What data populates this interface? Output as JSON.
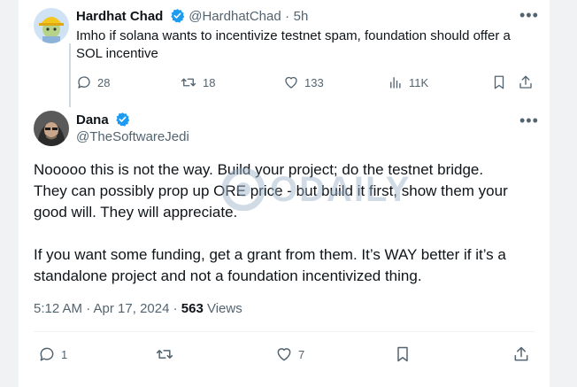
{
  "parent_tweet": {
    "author_name": "Hardhat Chad",
    "handle": "@HardhatChad",
    "separator": "·",
    "time": "5h",
    "text_line1": "Imho if solana wants to incentivize testnet spam, foundation should offer a",
    "text_line2": "SOL incentive",
    "replies": "28",
    "retweets": "18",
    "likes": "133",
    "views": "11K"
  },
  "main_tweet": {
    "author_name": "Dana",
    "handle": "@TheSoftwareJedi",
    "text_line1": "Nooooo this is not the way. Build your project; do the testnet bridge.",
    "text_line2": "They can possibly prop up ORE price - but build it first, show them your",
    "text_line3": "good will. They will appreciate.",
    "text_line4": "If you want some funding, get a grant from them. It’s WAY better if it’s a",
    "text_line5": "standalone project and not a foundation incentivized thing.",
    "timestamp": "5:12 AM · Apr 17, 2024 ·",
    "views_count": "563",
    "views_label": "Views",
    "replies": "1",
    "likes": "7"
  },
  "watermark": {
    "text": "ODAILY"
  },
  "icons": {
    "verified": "verified-badge-icon",
    "more": "more-icon",
    "reply": "reply-icon",
    "retweet": "retweet-icon",
    "like": "like-icon",
    "views": "views-icon",
    "bookmark": "bookmark-icon",
    "share": "share-icon"
  },
  "colors": {
    "verified_blue": "#1d9bf0",
    "text": "#0f1419",
    "muted": "#536471"
  }
}
